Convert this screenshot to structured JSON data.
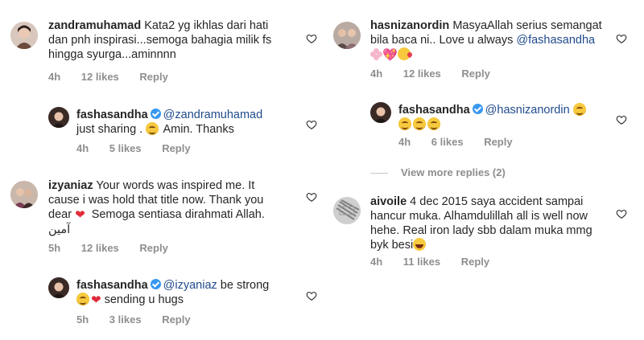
{
  "comments_left": [
    {
      "username": "zandramuhamad",
      "text": "Kata2 yg ikhlas dari hati\ndan pnh inspirasi...semoga bahagia milik fs\nhingga syurga...aminnnn",
      "time": "4h",
      "likes": "12 likes",
      "reply": "Reply"
    },
    {
      "username": "fashasandha",
      "mention": "@zandramuhamad",
      "text_line2": "just sharing .",
      "text_after": " Amin. Thanks",
      "time": "4h",
      "likes": "5 likes",
      "reply": "Reply"
    },
    {
      "username": "izyaniaz",
      "text_a": "Your words was inspired me. It\ncause i was hold that title now. Thank you\ndear ",
      "text_b": "  Semoga sentiasa dirahmati Allah.",
      "text_c": "آمين",
      "time": "5h",
      "likes": "12 likes",
      "reply": "Reply"
    },
    {
      "username": "fashasandha",
      "mention": "@izyaniaz",
      "text_after_mention": " be strong",
      "text_line2": " sending u hugs",
      "time": "5h",
      "likes": "3 likes",
      "reply": "Reply"
    }
  ],
  "comments_right": [
    {
      "username": "hasnizanordin",
      "text": "MasyaAllah serius semangat\nbila baca ni.. Love u always ",
      "mention": "@fashasandha",
      "time": "4h",
      "likes": "12 likes",
      "reply": "Reply"
    },
    {
      "username": "fashasandha",
      "mention": "@hasnizanordin",
      "time": "4h",
      "likes": "6 likes",
      "reply": "Reply"
    },
    {
      "view_more": "View more replies (2)"
    },
    {
      "username": "aivoile",
      "text": "4 dec 2015 saya accident sampai\nhancur muka. Alhamdulillah all is well now\nhehe. Real iron lady sbb dalam muka mmg\nbyk besi",
      "time": "4h",
      "likes": "11 likes",
      "reply": "Reply"
    }
  ],
  "icons": {
    "like": "heart-outline-icon",
    "verified": "verified-badge-icon"
  },
  "colors": {
    "text": "#262626",
    "meta": "#8e8e8e",
    "mention": "#1f4a8c",
    "verified": "#3897f0"
  }
}
